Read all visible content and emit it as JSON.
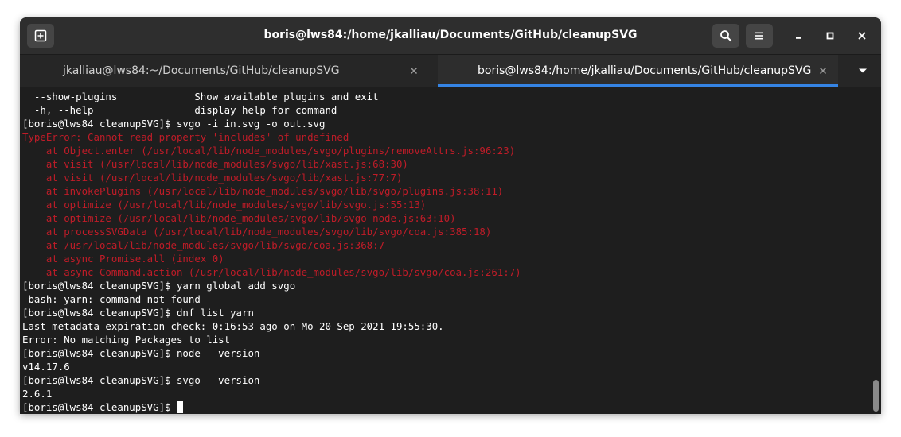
{
  "window": {
    "title": "boris@lws84:/home/jkalliau/Documents/GitHub/cleanupSVG"
  },
  "headerbar": {
    "new_tab_icon": "new-tab-icon",
    "search_icon": "search-icon",
    "menu_icon": "hamburger-menu-icon",
    "minimize_icon": "minimize-icon",
    "maximize_icon": "maximize-icon",
    "close_icon": "close-icon"
  },
  "tabs": [
    {
      "label": "jkalliau@lws84:~/Documents/GitHub/cleanupSVG",
      "active": false
    },
    {
      "label": "boris@lws84:/home/jkalliau/Documents/GitHub/cleanupSVG",
      "active": true
    }
  ],
  "colors": {
    "error_text": "#c01c28",
    "accent": "#3584e4",
    "terminal_bg": "#1e1e1e"
  },
  "terminal": {
    "lines": [
      {
        "text": "  --show-plugins             Show available plugins and exit",
        "kind": "normal"
      },
      {
        "text": "  -h, --help                 display help for command",
        "kind": "normal"
      },
      {
        "text": "[boris@lws84 cleanupSVG]$ svgo -i in.svg -o out.svg",
        "kind": "normal"
      },
      {
        "text": "TypeError: Cannot read property 'includes' of undefined",
        "kind": "error"
      },
      {
        "text": "    at Object.enter (/usr/local/lib/node_modules/svgo/plugins/removeAttrs.js:96:23)",
        "kind": "error"
      },
      {
        "text": "    at visit (/usr/local/lib/node_modules/svgo/lib/xast.js:68:30)",
        "kind": "error"
      },
      {
        "text": "    at visit (/usr/local/lib/node_modules/svgo/lib/xast.js:77:7)",
        "kind": "error"
      },
      {
        "text": "    at invokePlugins (/usr/local/lib/node_modules/svgo/lib/svgo/plugins.js:38:11)",
        "kind": "error"
      },
      {
        "text": "    at optimize (/usr/local/lib/node_modules/svgo/lib/svgo.js:55:13)",
        "kind": "error"
      },
      {
        "text": "    at optimize (/usr/local/lib/node_modules/svgo/lib/svgo-node.js:63:10)",
        "kind": "error"
      },
      {
        "text": "    at processSVGData (/usr/local/lib/node_modules/svgo/lib/svgo/coa.js:385:18)",
        "kind": "error"
      },
      {
        "text": "    at /usr/local/lib/node_modules/svgo/lib/svgo/coa.js:368:7",
        "kind": "error"
      },
      {
        "text": "    at async Promise.all (index 0)",
        "kind": "error"
      },
      {
        "text": "    at async Command.action (/usr/local/lib/node_modules/svgo/lib/svgo/coa.js:261:7)",
        "kind": "error"
      },
      {
        "text": "[boris@lws84 cleanupSVG]$ yarn global add svgo",
        "kind": "normal"
      },
      {
        "text": "-bash: yarn: command not found",
        "kind": "normal"
      },
      {
        "text": "[boris@lws84 cleanupSVG]$ dnf list yarn",
        "kind": "normal"
      },
      {
        "text": "Last metadata expiration check: 0:16:53 ago on Mo 20 Sep 2021 19:55:30.",
        "kind": "normal"
      },
      {
        "text": "Error: No matching Packages to list",
        "kind": "normal"
      },
      {
        "text": "[boris@lws84 cleanupSVG]$ node --version",
        "kind": "normal"
      },
      {
        "text": "v14.17.6",
        "kind": "normal"
      },
      {
        "text": "[boris@lws84 cleanupSVG]$ svgo --version",
        "kind": "normal"
      },
      {
        "text": "2.6.1",
        "kind": "normal"
      }
    ],
    "prompt": "[boris@lws84 cleanupSVG]$ "
  }
}
